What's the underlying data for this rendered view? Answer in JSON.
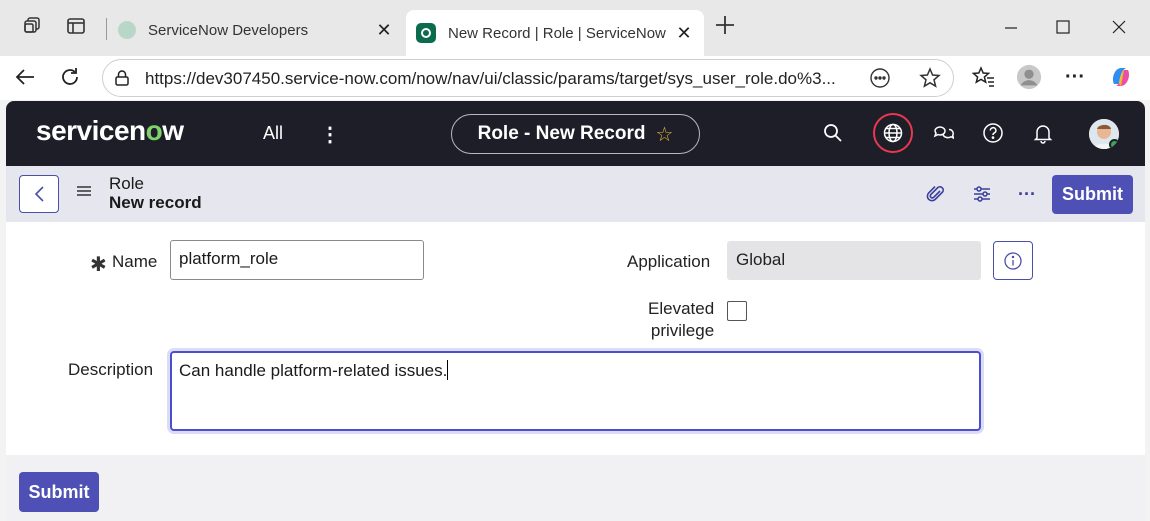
{
  "browser": {
    "tabs": [
      {
        "title": "ServiceNow Developers",
        "active": false
      },
      {
        "title": "New Record | Role | ServiceNow",
        "active": true
      }
    ],
    "url": "https://dev307450.service-now.com/now/nav/ui/classic/params/target/sys_user_role.do%3..."
  },
  "header": {
    "logo": "servicenow",
    "all_label": "All",
    "pill_title": "Role - New Record",
    "favorite_icon": "star-icon"
  },
  "record_bar": {
    "table_name": "Role",
    "record_state": "New record",
    "submit_label": "Submit"
  },
  "form": {
    "name_label": "Name",
    "name_value": "platform_role",
    "application_label": "Application",
    "application_value": "Global",
    "elevated_label_line1": "Elevated",
    "elevated_label_line2": "privilege",
    "elevated_checked": false,
    "description_label": "Description",
    "description_value": "Can handle platform-related issues."
  },
  "footer": {
    "submit_label": "Submit"
  },
  "colors": {
    "header_bg": "#1e1e28",
    "accent": "#4e50b5",
    "logo_accent": "#7fd36b",
    "globe_ring": "#e8384f"
  }
}
